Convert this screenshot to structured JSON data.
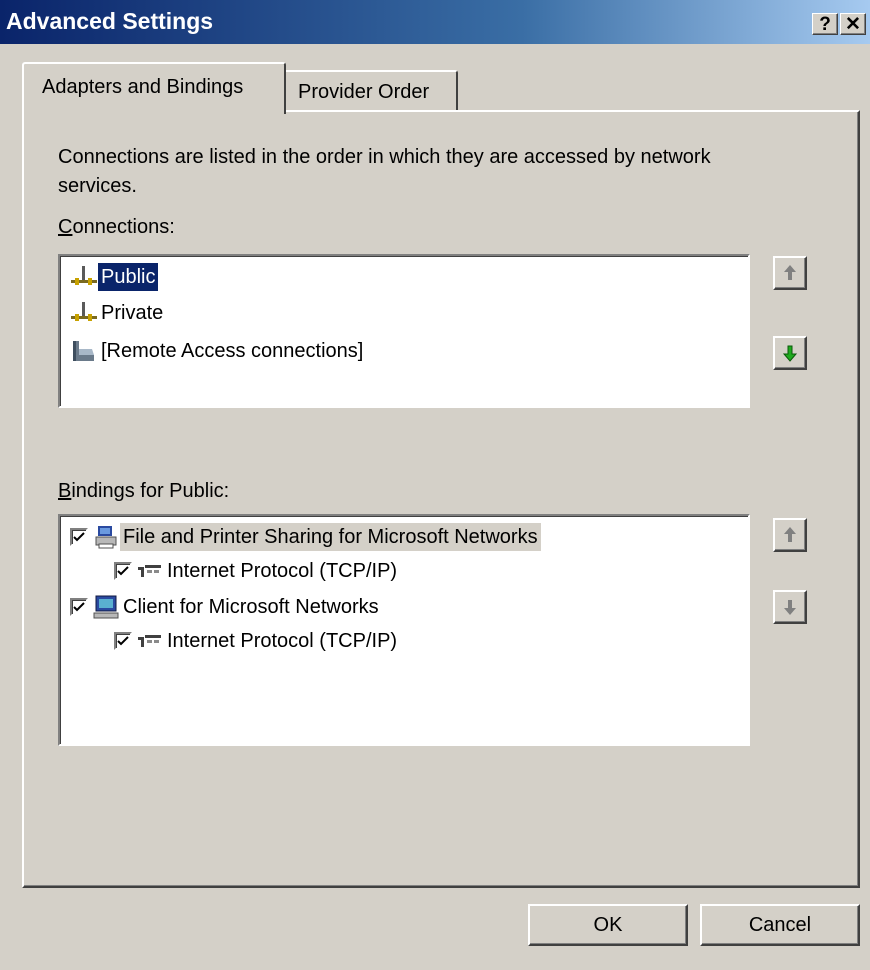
{
  "window": {
    "title": "Advanced Settings",
    "help_glyph": "?",
    "close_glyph": "✕"
  },
  "tabs": [
    {
      "label": "Adapters and Bindings",
      "active": true
    },
    {
      "label": "Provider Order",
      "active": false
    }
  ],
  "description": "Connections are listed in the order in which they are accessed by network services.",
  "connections": {
    "label_accel": "C",
    "label_rest": "onnections:",
    "items": [
      {
        "label": "Public",
        "icon": "network-connection-icon",
        "selected": true
      },
      {
        "label": "Private",
        "icon": "network-connection-icon",
        "selected": false
      },
      {
        "label": "[Remote Access connections]",
        "icon": "remote-access-icon",
        "selected": false
      }
    ]
  },
  "bindings": {
    "label_accel": "B",
    "label_rest": "indings for Public:",
    "items": [
      {
        "label": "File and Printer Sharing for Microsoft Networks",
        "icon": "file-printer-sharing-icon",
        "checked": true,
        "indent": 0
      },
      {
        "label": "Internet Protocol (TCP/IP)",
        "icon": "protocol-icon",
        "checked": true,
        "indent": 1
      },
      {
        "label": "Client for Microsoft Networks",
        "icon": "network-client-icon",
        "checked": true,
        "indent": 0
      },
      {
        "label": "Internet Protocol (TCP/IP)",
        "icon": "protocol-icon",
        "checked": true,
        "indent": 1
      }
    ]
  },
  "buttons": {
    "ok": "OK",
    "cancel": "Cancel"
  },
  "colors": {
    "titlebar_start": "#0a246a",
    "titlebar_end": "#a6caf0",
    "selection": "#0a246a",
    "face": "#d4d0c8",
    "arrow_green": "#1faa1f"
  }
}
